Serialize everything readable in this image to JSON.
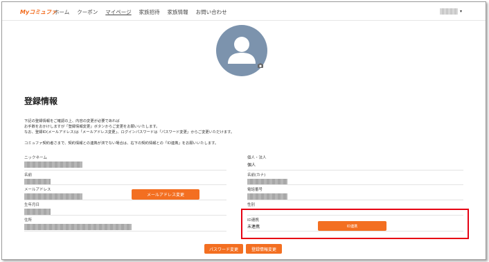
{
  "nav": {
    "logo": "Myコミュファ",
    "items": [
      "ホーム",
      "クーポン",
      "マイページ",
      "家族招待",
      "家族情報",
      "お問い合わせ"
    ],
    "user_caret": "▾"
  },
  "page": {
    "title": "登録情報",
    "notes": [
      "下記の登録情報をご確認の上、内容の変更が必要であれば",
      "お手数をおかけしますが「登録情報変更」ボタンからご変更をお願いいたします。",
      "なお、登録ID(メールアドレス)は「メールアドレス変更」、ログインパスワードは「パスワード変更」からご変更いただけます。",
      "",
      "コミュファ契約者さまで、契約情報との連携が済でない場合は、右下の契約情報との「ID連携」をお願いいたします。"
    ]
  },
  "fields": {
    "nickname": "ニックネーム",
    "name": "名前",
    "email": "メールアドレス",
    "birthday": "生年月日",
    "address": "住所",
    "account_type": "個人・法人",
    "account_type_value": "個人",
    "name_kana": "名前(カナ)",
    "phone": "電話番号",
    "gender": "性別",
    "id_link": "ID連携",
    "id_link_value": "未連携"
  },
  "buttons": {
    "email_change": "メールアドレス変更",
    "id_link": "ID連携",
    "password_change": "パスワード変更",
    "profile_change": "登録情報変更"
  },
  "colors": {
    "accent": "#f36f21",
    "highlight": "#e60012",
    "avatar_bg": "#7c93ad"
  }
}
